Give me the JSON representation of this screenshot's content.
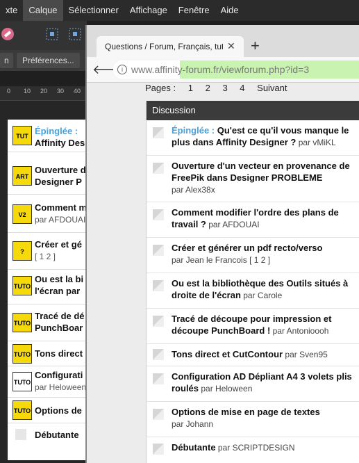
{
  "app": {
    "menu": [
      "xte",
      "Calque",
      "Sélectionner",
      "Affichage",
      "Fenêtre",
      "Aide"
    ],
    "active_menu": "Calque",
    "ctx_buttons": [
      "n",
      "Préférences..."
    ],
    "ruler_numbers": [
      "0",
      "10",
      "20",
      "30",
      "40"
    ],
    "bg_rows": [
      {
        "icon": "TUT",
        "pre": "Épinglée : ",
        "title": "",
        "line2": "Affinity Des"
      },
      {
        "icon": "ART",
        "pre": "",
        "title": "Ouverture d",
        "line2": "Designer P"
      },
      {
        "icon": "V2",
        "pre": "",
        "title": "Comment m",
        "line2": "par AFDOUAI"
      },
      {
        "icon": "?",
        "pre": "",
        "title": "Créer et gé",
        "line2": "[ 1 2 ]"
      },
      {
        "icon": "TUTO",
        "pre": "",
        "title": "Ou est la bi",
        "line2": "l'écran par"
      },
      {
        "icon": "TUTO",
        "pre": "",
        "title": "Tracé de dé",
        "line2": "PunchBoar"
      },
      {
        "icon": "TUTO",
        "pre": "",
        "title": "Tons direct",
        "line2": ""
      },
      {
        "icon": "TUTO",
        "pre": "",
        "title": "Configurati",
        "line2": "par Heloween"
      },
      {
        "icon": "TUTO",
        "pre": "",
        "title": "Options de",
        "line2": ""
      },
      {
        "icon": "",
        "pre": "",
        "title": "Débutante",
        "line2": ""
      }
    ]
  },
  "browser": {
    "tab_title": "Questions / Forum, Français, tuto",
    "url_domain": "www.affinity-forum.fr",
    "url_path": "/viewforum.php?id=3",
    "pages_label": "Pages :",
    "pages": [
      "1",
      "2",
      "3",
      "4",
      "Suivant"
    ],
    "section_title": "Discussion",
    "topics": [
      {
        "pinned": "Épinglée : ",
        "title": "Qu'est ce qu'il vous manque le plus dans Affinity Designer ?",
        "by": " par vMiKL",
        "pagelist": ""
      },
      {
        "pinned": "",
        "title": "Ouverture d'un vecteur en provenance de FreePik dans Designer PROBLEME",
        "by": "par Alex38x",
        "pagelist": ""
      },
      {
        "pinned": "",
        "title": "Comment modifier l'ordre des plans de travail ?",
        "by": " par AFDOUAI",
        "pagelist": ""
      },
      {
        "pinned": "",
        "title": "Créer et générer un pdf recto/verso",
        "by": "par Jean le Francois",
        "pagelist": " [ 1 2 ]"
      },
      {
        "pinned": "",
        "title": "Ou est la bibliothèque des Outils situés à droite de l'écran",
        "by": " par Carole",
        "pagelist": ""
      },
      {
        "pinned": "",
        "title": "Tracé de découpe pour impression et découpe PunchBoard !",
        "by": " par Antonioooh",
        "pagelist": ""
      },
      {
        "pinned": "",
        "title": "Tons direct et CutContour",
        "by": " par Sven95",
        "pagelist": ""
      },
      {
        "pinned": "",
        "title": "Configuration AD Dépliant A4 3 volets plis roulés",
        "by": " par Heloween",
        "pagelist": ""
      },
      {
        "pinned": "",
        "title": "Options de mise en page de textes",
        "by": "par Johann",
        "pagelist": ""
      },
      {
        "pinned": "",
        "title": "Débutante",
        "by": " par SCRIPTDESIGN",
        "pagelist": ""
      }
    ]
  }
}
